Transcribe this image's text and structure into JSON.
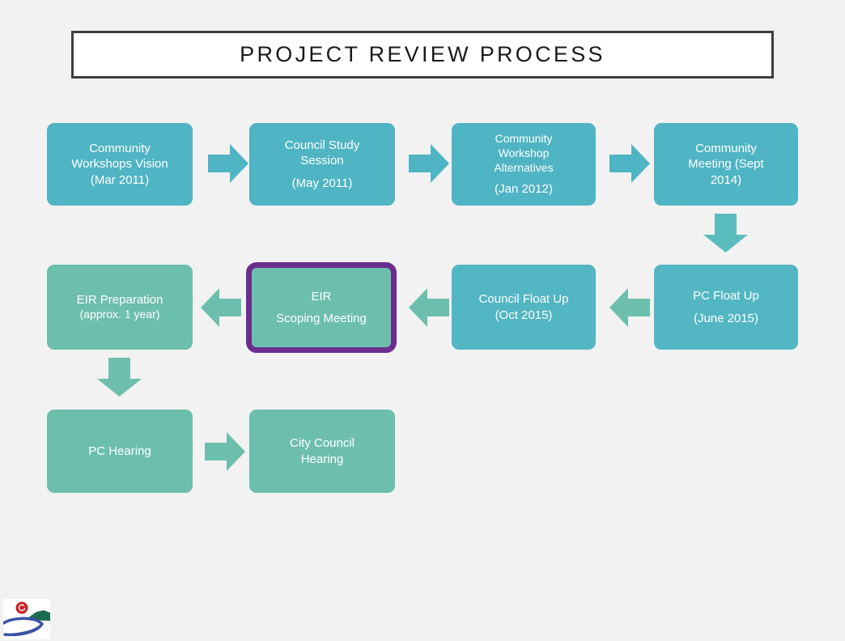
{
  "slide": {
    "title": "PROJECT REVIEW PROCESS",
    "background_color": "#f2f2f2",
    "title_border_color": "#3f3f3f",
    "title_fill_color": "#ffffff"
  },
  "colors": {
    "teal": "#4fb4c3",
    "green": "#6cbfac",
    "green_blue": "#52b6c3",
    "highlight_outline": "#6b2d8f",
    "arrow_teal": "#4fb4c3",
    "arrow_green": "#6cbfac",
    "logo_red": "#cc2229",
    "logo_green": "#1d6b4f",
    "logo_blue": "#3a53a4"
  },
  "flow": {
    "row1": [
      {
        "name": "community-workshops-vision",
        "lines": [
          "Community",
          "Workshops Vision",
          "(Mar 2011)"
        ],
        "color": "teal"
      },
      {
        "name": "council-study-session",
        "lines": [
          "Council Study",
          "Session",
          "(May 2011)"
        ],
        "color": "teal"
      },
      {
        "name": "community-workshop-alternatives",
        "lines": [
          "Community",
          "Workshop",
          "Alternatives",
          "(Jan 2012)"
        ],
        "color": "teal"
      },
      {
        "name": "community-meeting",
        "lines": [
          "Community",
          "Meeting (Sept",
          "2014)"
        ],
        "color": "teal"
      }
    ],
    "row2": [
      {
        "name": "eir-preparation",
        "lines": [
          "EIR Preparation",
          "(approx. 1 year)"
        ],
        "color": "green"
      },
      {
        "name": "eir-scoping-meeting",
        "lines": [
          "EIR",
          "Scoping Meeting"
        ],
        "color": "green",
        "outlined": true
      },
      {
        "name": "council-float-up",
        "lines": [
          "Council Float Up",
          "(Oct  2015)"
        ],
        "color": "green_blue"
      },
      {
        "name": "pc-float-up",
        "lines": [
          "PC Float Up",
          "(June 2015)"
        ],
        "color": "green_blue"
      }
    ],
    "row3": [
      {
        "name": "pc-hearing",
        "lines": [
          "PC Hearing"
        ],
        "color": "green"
      },
      {
        "name": "city-council-hearing",
        "lines": [
          "City Council",
          "Hearing"
        ],
        "color": "green"
      }
    ]
  },
  "arrows": [
    {
      "name": "arrow-row1-1-to-2",
      "direction": "right"
    },
    {
      "name": "arrow-row1-2-to-3",
      "direction": "right"
    },
    {
      "name": "arrow-row1-3-to-4",
      "direction": "right"
    },
    {
      "name": "arrow-row1-4-to-row2-4",
      "direction": "down"
    },
    {
      "name": "arrow-row2-4-to-3",
      "direction": "left"
    },
    {
      "name": "arrow-row2-3-to-2",
      "direction": "left"
    },
    {
      "name": "arrow-row2-2-to-1",
      "direction": "left"
    },
    {
      "name": "arrow-row2-1-to-row3-1",
      "direction": "down"
    },
    {
      "name": "arrow-row3-1-to-2",
      "direction": "right"
    }
  ],
  "logo": {
    "name": "city-logo",
    "description": "sun hill and river logo"
  }
}
